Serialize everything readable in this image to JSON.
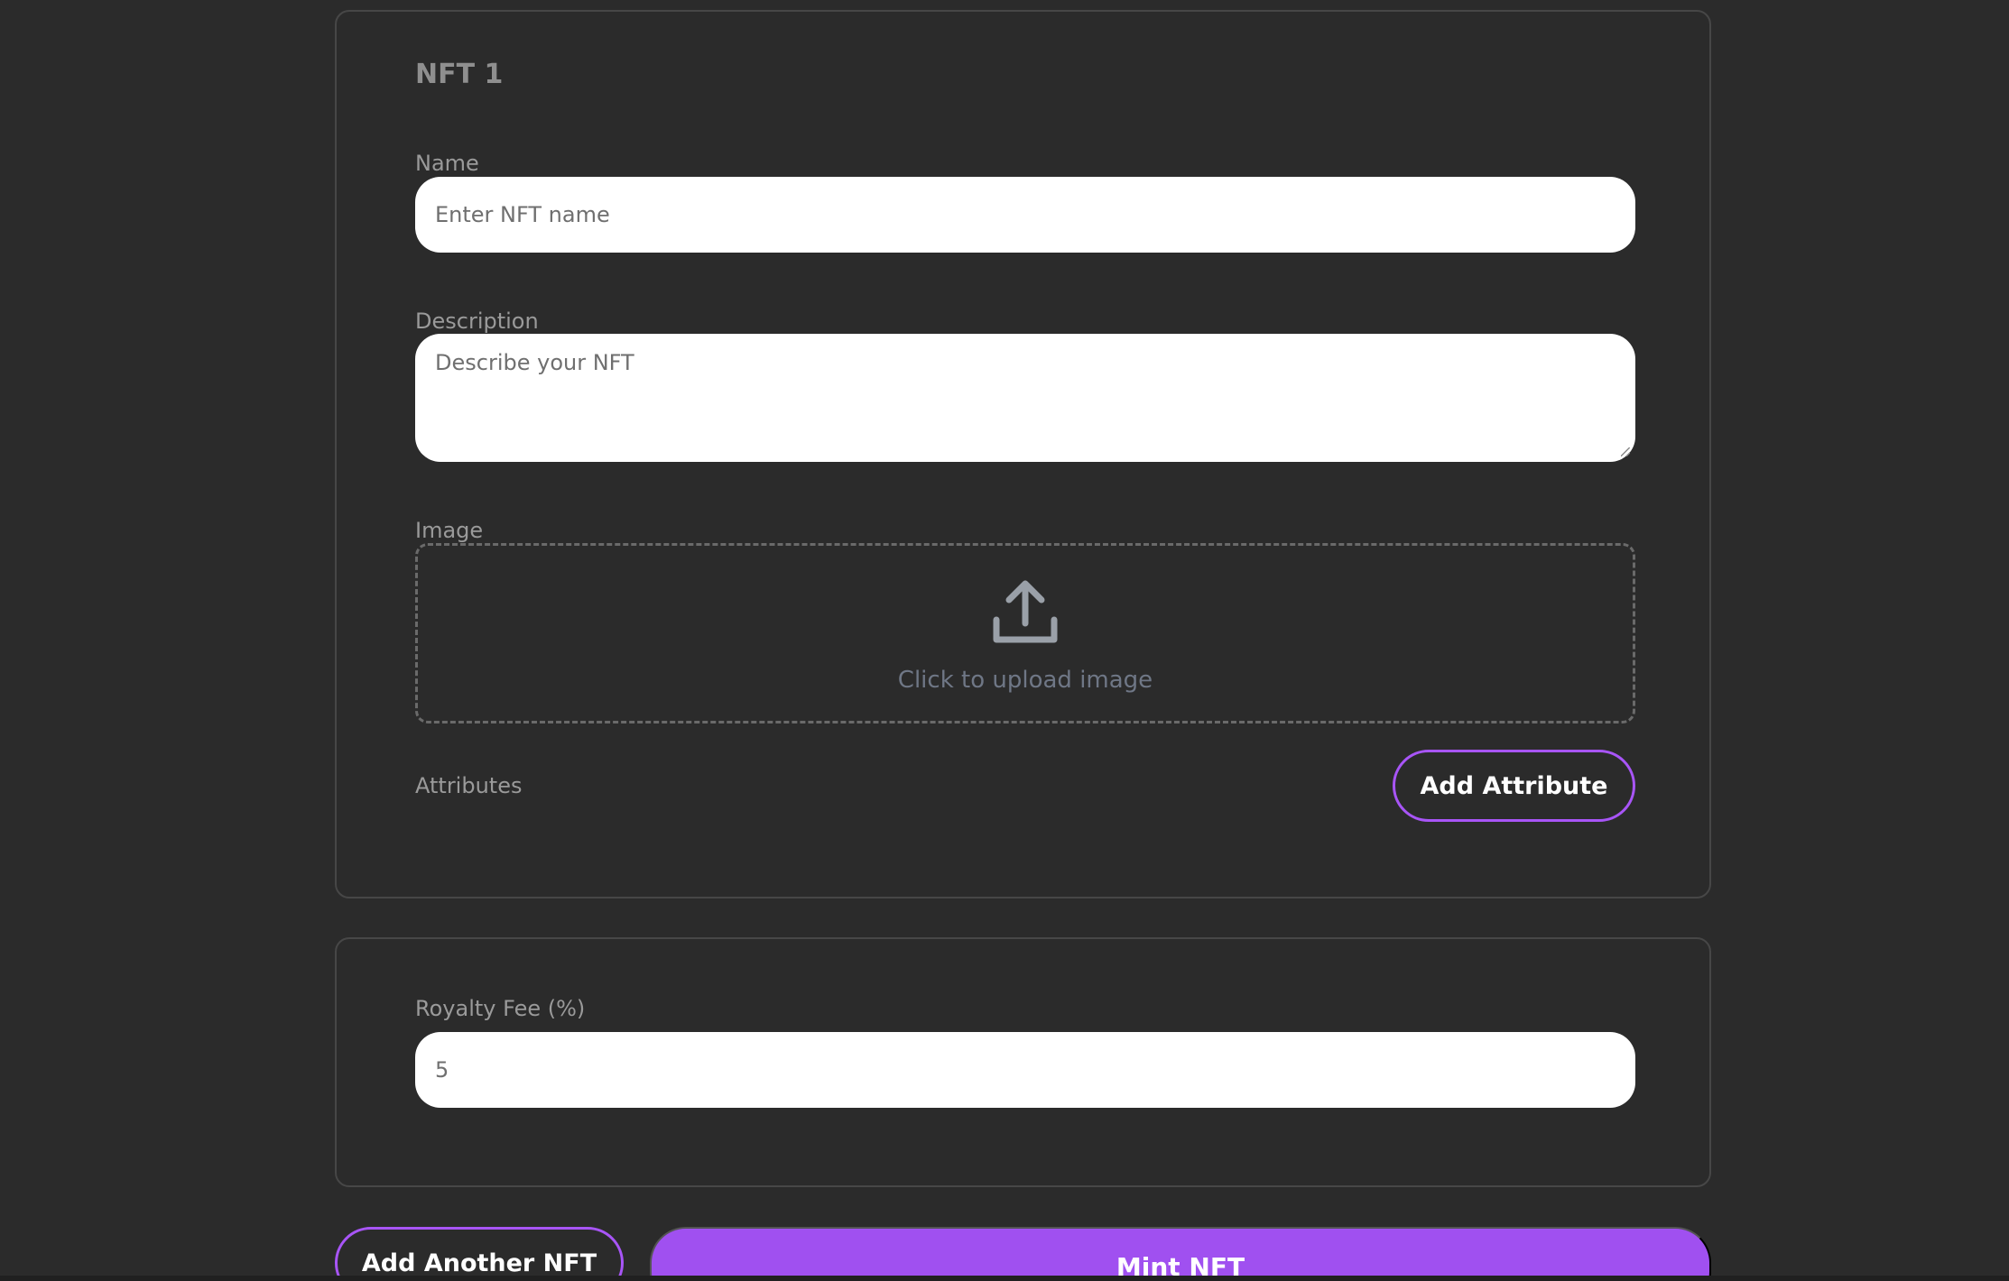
{
  "nft_card": {
    "title": "NFT 1",
    "name_label": "Name",
    "name_placeholder": "Enter NFT name",
    "description_label": "Description",
    "description_placeholder": "Describe your NFT",
    "image_label": "Image",
    "upload_text": "Click to upload image",
    "upload_icon": "upload-icon",
    "attributes_label": "Attributes",
    "add_attribute_label": "Add Attribute"
  },
  "royalty_card": {
    "label": "Royalty Fee (%)",
    "value": "5"
  },
  "actions": {
    "add_another_label": "Add Another NFT",
    "mint_label": "Mint NFT"
  },
  "colors": {
    "background": "#2b2b2b",
    "accent": "#a855f7",
    "mint_button": "#a050f0"
  }
}
